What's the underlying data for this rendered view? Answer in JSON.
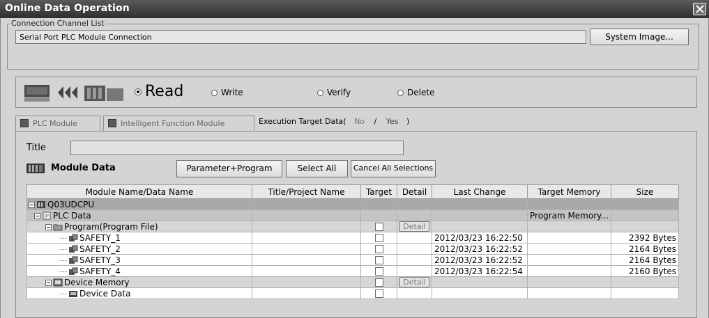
{
  "window": {
    "title": "Online Data Operation"
  },
  "connection": {
    "legend": "Connection Channel List",
    "value": "Serial Port  PLC Module Connection",
    "system_image_button": "System Image..."
  },
  "mode": {
    "options": [
      {
        "label": "Read",
        "selected": true
      },
      {
        "label": "Write",
        "selected": false
      },
      {
        "label": "Verify",
        "selected": false
      },
      {
        "label": "Delete",
        "selected": false
      }
    ]
  },
  "tabs": [
    {
      "label": "PLC Module"
    },
    {
      "label": "Intelligent Function Module"
    }
  ],
  "execution_target": {
    "label": "Execution Target Data(",
    "no": "No",
    "sep": "/",
    "yes": "Yes",
    "close": ")"
  },
  "title_label": "Title",
  "module_data": {
    "header": "Module Data",
    "buttons": {
      "param_program": "Parameter+Program",
      "select_all": "Select All",
      "cancel_all": "Cancel All Selections"
    }
  },
  "table": {
    "columns": [
      "Module Name/Data Name",
      "Title/Project Name",
      "Target",
      "Detail",
      "Last Change",
      "Target Memory",
      "Size"
    ],
    "rows": [
      {
        "name": "Q03UDCPU",
        "title": "",
        "target": false,
        "detail": "",
        "last_change": "",
        "memory": "",
        "size": "",
        "level": 0,
        "style": "g1",
        "icon": "cpu-icon",
        "checkbox": false
      },
      {
        "name": "PLC Data",
        "title": "",
        "target": false,
        "detail": "",
        "last_change": "",
        "memory": "Program Memory...",
        "size": "",
        "level": 1,
        "style": "g2",
        "icon": "plc-data-icon",
        "checkbox": false
      },
      {
        "name": "Program(Program File)",
        "title": "",
        "target": true,
        "detail": "Detail",
        "last_change": "",
        "memory": "",
        "size": "",
        "level": 2,
        "style": "g3",
        "icon": "program-folder-icon",
        "checkbox": true
      },
      {
        "name": "SAFETY_1",
        "title": "",
        "target": true,
        "detail": "",
        "last_change": "2012/03/23 16:22:50",
        "memory": "",
        "size": "2392 Bytes",
        "level": 3,
        "style": "",
        "icon": "program-file-icon",
        "checkbox": true
      },
      {
        "name": "SAFETY_2",
        "title": "",
        "target": true,
        "detail": "",
        "last_change": "2012/03/23 16:22:52",
        "memory": "",
        "size": "2164 Bytes",
        "level": 3,
        "style": "",
        "icon": "program-file-icon",
        "checkbox": true
      },
      {
        "name": "SAFETY_3",
        "title": "",
        "target": true,
        "detail": "",
        "last_change": "2012/03/23 16:22:52",
        "memory": "",
        "size": "2164 Bytes",
        "level": 3,
        "style": "",
        "icon": "program-file-icon",
        "checkbox": true
      },
      {
        "name": "SAFETY_4",
        "title": "",
        "target": true,
        "detail": "",
        "last_change": "2012/03/23 16:22:54",
        "memory": "",
        "size": "2160 Bytes",
        "level": 3,
        "style": "",
        "icon": "program-file-icon",
        "checkbox": true
      },
      {
        "name": "Device Memory",
        "title": "",
        "target": true,
        "detail": "Detail",
        "last_change": "",
        "memory": "",
        "size": "",
        "level": 2,
        "style": "g3",
        "icon": "device-memory-icon",
        "checkbox": true
      },
      {
        "name": "Device Data",
        "title": "",
        "target": true,
        "detail": "",
        "last_change": "",
        "memory": "",
        "size": "",
        "level": 3,
        "style": "",
        "icon": "device-data-icon",
        "checkbox": true
      }
    ]
  }
}
